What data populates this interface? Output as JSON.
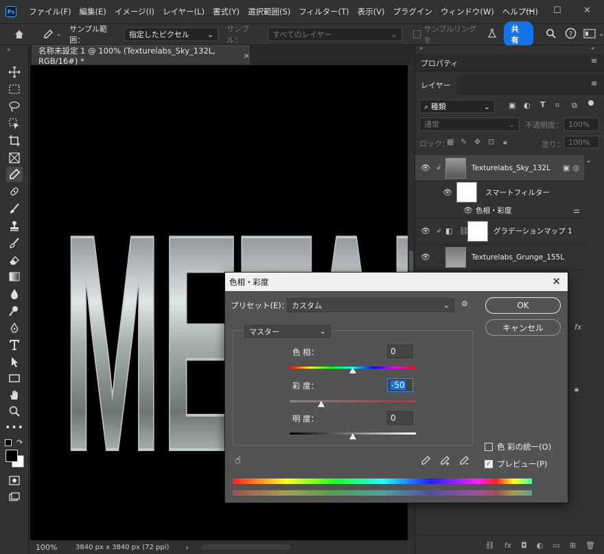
{
  "menu": [
    "ファイル(F)",
    "編集(E)",
    "イメージ(I)",
    "レイヤー(L)",
    "書式(Y)",
    "選択範囲(S)",
    "フィルター(T)",
    "表示(V)",
    "プラグイン",
    "ウィンドウ(W)",
    "ヘルプ(H)"
  ],
  "logo": "Ps",
  "options": {
    "sample_range_label": "サンプル範囲：",
    "sample_range_value": "指定したピクセル",
    "sample_label": "サンプル：",
    "sample_value": "すべてのレイヤー",
    "sampling_ring_label": "サンプルリングを",
    "share_label": "共有"
  },
  "document_tab": {
    "title": "名称未設定 1 @ 100% (Texturelabs_Sky_132L, RGB/16#) *",
    "close": "×"
  },
  "canvas": {
    "text": "METAL"
  },
  "status": {
    "zoom": "100%",
    "info": "3840 px x 3840 px (72 ppi)",
    "arrow": "›"
  },
  "panels": {
    "properties_tab": "プロパティ",
    "layers_tab": "レイヤー",
    "filter_kind": "種類",
    "blend_mode": "通常",
    "opacity_label": "不透明度：",
    "opacity_value": "100%",
    "lock_label": "ロック：",
    "fill_label": "塗り：",
    "fill_value": "100%",
    "layers": [
      {
        "name": "Texturelabs_Sky_132L"
      },
      {
        "name": "スマートフィルター"
      },
      {
        "name": "色相・彩度"
      },
      {
        "name": "グラデーションマップ 1"
      },
      {
        "name": "Texturelabs_Grunge_155L"
      }
    ],
    "fx": "fx"
  },
  "dialog": {
    "title": "色相・彩度",
    "close": "✕",
    "preset_label": "プリセット(E)：",
    "preset_value": "カスタム",
    "ok": "OK",
    "cancel": "キャンセル",
    "channel": "マスター",
    "hue_label": "色 相：",
    "hue_value": "0",
    "sat_label": "彩 度：",
    "sat_value": "-50",
    "light_label": "明 度：",
    "light_value": "0",
    "colorize_label": "色 彩の統一(O)",
    "colorize_checked": false,
    "preview_label": "プレビュー(P)",
    "preview_checked": true,
    "hue_fraction": 0.5,
    "sat_fraction": 0.25,
    "light_fraction": 0.5
  },
  "colors": {
    "accent": "#1473e6",
    "canvas": "#000000",
    "panel": "#323232",
    "dialog": "#535353"
  }
}
